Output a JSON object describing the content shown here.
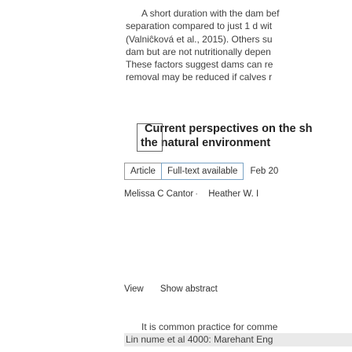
{
  "top_snippet": {
    "lines": [
      "A short duration with the dam bef",
      "separation compared to just 1 d wit",
      "(Valniĉková et al., 2015). Others su",
      "dam but are not nutritionally depen",
      "These factors suggest dams can re",
      "removal may be reduced if calves r"
    ]
  },
  "article": {
    "title_line_1": "Current perspectives on the sh",
    "title_line_2": "the natural environment",
    "type_badge": "Article",
    "fulltext_badge": "Full-text available",
    "date": "Feb 20",
    "authors": [
      "Melissa C Cantor",
      "Heather W. I"
    ]
  },
  "links": {
    "view": "View",
    "abstract": "Show abstract"
  },
  "bottom_snippet": {
    "lines": [
      "It is common practice for comme",
      "Lin nume et al 4000: Marehant Eng"
    ]
  }
}
